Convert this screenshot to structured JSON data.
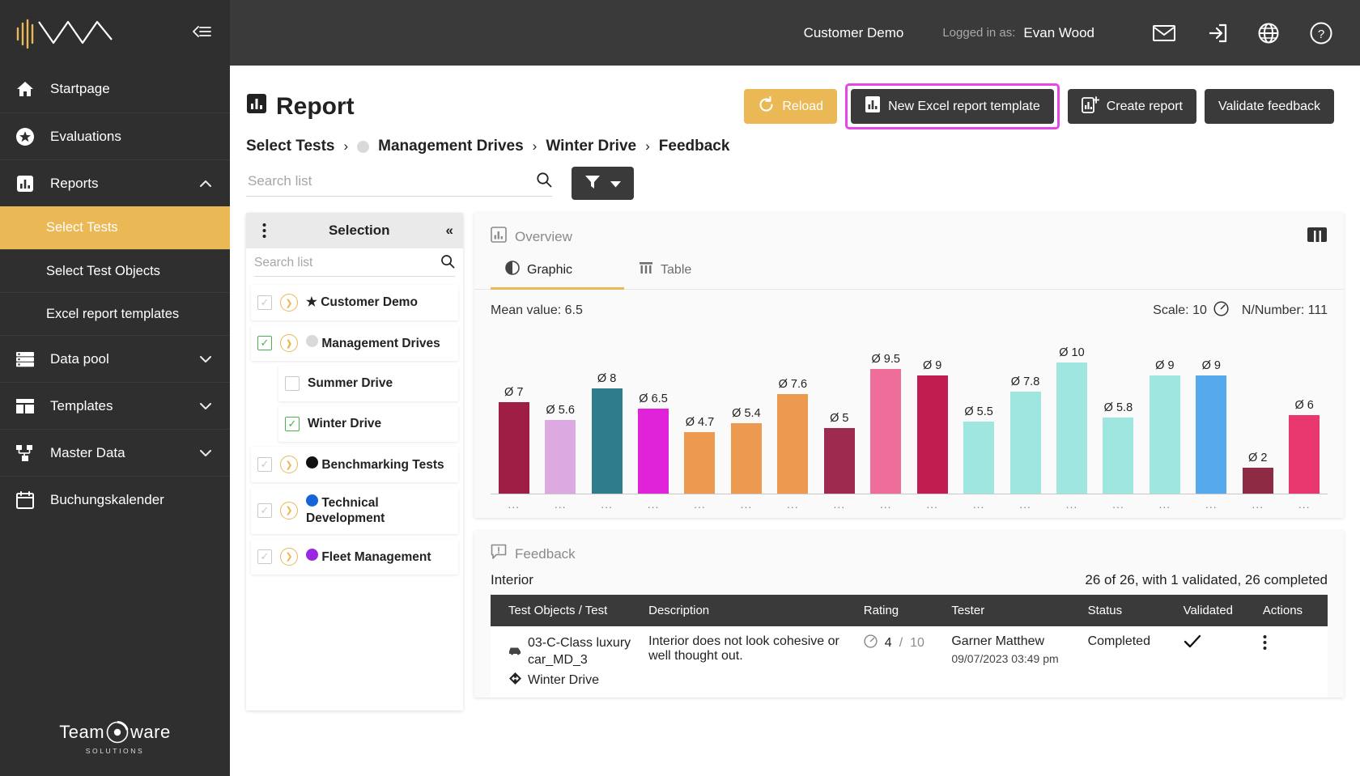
{
  "sidebar": {
    "logo_name": "waveline-logo",
    "collapse_icon": "collapse-sidebar-icon",
    "items": [
      {
        "label": "Startpage",
        "icon": "home-icon",
        "chevron": ""
      },
      {
        "label": "Evaluations",
        "icon": "star-circle-icon",
        "chevron": ""
      },
      {
        "label": "Reports",
        "icon": "bar-chart-icon",
        "chevron": "⌃"
      },
      {
        "label": "Data pool",
        "icon": "list-icon",
        "chevron": "⌄"
      },
      {
        "label": "Templates",
        "icon": "layout-icon",
        "chevron": "⌄"
      },
      {
        "label": "Master Data",
        "icon": "hierarchy-icon",
        "chevron": "⌄"
      },
      {
        "label": "Buchungskalender",
        "icon": "calendar-icon",
        "chevron": ""
      }
    ],
    "sub_items": [
      {
        "label": "Select Tests",
        "active": true
      },
      {
        "label": "Select Test Objects",
        "active": false
      },
      {
        "label": "Excel report templates",
        "active": false
      }
    ],
    "footer": {
      "brand": "Team",
      "brand2": "ware",
      "tagline": "SOLUTIONS"
    }
  },
  "topbar": {
    "customer": "Customer Demo",
    "logged_in_label": "Logged in as:",
    "user": "Evan Wood",
    "icons": [
      "mail-icon",
      "logout-icon",
      "globe-icon",
      "help-icon"
    ]
  },
  "page": {
    "title": "Report",
    "title_icon": "report-icon",
    "buttons": [
      {
        "label": "Reload",
        "icon": "refresh-icon",
        "style": "amber"
      },
      {
        "label": "New Excel report template",
        "icon": "excel-report-icon",
        "style": "dark",
        "highlighted": true
      },
      {
        "label": "Create report",
        "icon": "create-report-icon",
        "style": "dark"
      },
      {
        "label": "Validate feedback",
        "icon": "",
        "style": "dark"
      }
    ]
  },
  "breadcrumb": [
    {
      "label": "Select Tests",
      "dot": ""
    },
    {
      "label": "Management Drives",
      "dot": "#d9d9d9"
    },
    {
      "label": "Winter Drive",
      "dot": ""
    },
    {
      "label": "Feedback",
      "dot": ""
    }
  ],
  "search": {
    "placeholder": "Search list",
    "value": "",
    "icon": "search-icon"
  },
  "filter": {
    "icon": "filter-icon",
    "chevron": "▾"
  },
  "selection": {
    "title": "Selection",
    "kebab_icon": "kebab-menu-icon",
    "collapse_icon": "collapse-panel-icon",
    "search_placeholder": "Search list",
    "search_value": "",
    "tree": [
      {
        "label": "Customer Demo",
        "checkbox": "indeterminate",
        "expander": "›",
        "marker": "★",
        "marker_color": "#000000",
        "child": false
      },
      {
        "label": "Management Drives",
        "checkbox": "checked",
        "expander": "⌄",
        "marker": "●",
        "marker_color": "#d9d9d9",
        "child": false
      },
      {
        "label": "Summer Drive",
        "checkbox": "empty",
        "expander": "",
        "marker": "",
        "marker_color": "",
        "child": true
      },
      {
        "label": "Winter Drive",
        "checkbox": "checked",
        "expander": "",
        "marker": "",
        "marker_color": "",
        "child": true
      },
      {
        "label": "Benchmarking Tests",
        "checkbox": "indeterminate",
        "expander": "›",
        "marker": "●",
        "marker_color": "#111111",
        "child": false
      },
      {
        "label": "Technical Development",
        "checkbox": "indeterminate",
        "expander": "›",
        "marker": "●",
        "marker_color": "#1565d8",
        "child": false
      },
      {
        "label": "Fleet Management",
        "checkbox": "indeterminate",
        "expander": "›",
        "marker": "●",
        "marker_color": "#9c27e0",
        "child": false
      }
    ]
  },
  "overview": {
    "title": "Overview",
    "icon": "chart-icon",
    "grid_icon": "columns-icon",
    "tabs": [
      {
        "label": "Graphic",
        "icon": "pie-icon",
        "active": true
      },
      {
        "label": "Table",
        "icon": "table-icon",
        "active": false
      }
    ]
  },
  "chart_data": {
    "type": "bar",
    "title": "Mean value: 6.5",
    "mean_label": "Mean value: 6.5",
    "mean_value": 6.5,
    "scale_label": "Scale: 10",
    "scale_icon": "gauge-icon",
    "n_number_label": "N/Number: 111",
    "xlabel": "",
    "ylabel": "",
    "ylim": [
      0,
      10
    ],
    "grid": false,
    "legend": "none",
    "categories": [
      "...",
      "...",
      "...",
      "...",
      "...",
      "...",
      "...",
      "...",
      "...",
      "...",
      "...",
      "...",
      "...",
      "...",
      "...",
      "...",
      "...",
      "..."
    ],
    "value_labels": [
      "Ø 7",
      "Ø 5.6",
      "Ø 8",
      "Ø 6.5",
      "Ø 4.7",
      "Ø 5.4",
      "Ø 7.6",
      "Ø 5",
      "Ø 9.5",
      "Ø 9",
      "Ø 5.5",
      "Ø 7.8",
      "Ø 10",
      "Ø 5.8",
      "Ø 9",
      "Ø 9",
      "Ø 2",
      "Ø 6"
    ],
    "values": [
      7,
      5.6,
      8,
      6.5,
      4.7,
      5.4,
      7.6,
      5,
      9.5,
      9,
      5.5,
      7.8,
      10,
      5.8,
      9,
      9,
      2,
      6
    ],
    "colors": [
      "#9e1f43",
      "#dca9e0",
      "#2f7d8c",
      "#e022d8",
      "#eb9a4f",
      "#eb9a4f",
      "#eb9a4f",
      "#9e2a50",
      "#ef6d9b",
      "#c01d51",
      "#9fe5e0",
      "#9fe5e0",
      "#9fe5e0",
      "#9fe5e0",
      "#9fe5e0",
      "#56a9ec",
      "#8d2b45",
      "#e8386e"
    ]
  },
  "feedback": {
    "title": "Feedback",
    "icon": "feedback-icon",
    "group": "Interior",
    "count_text": "26 of 26, with 1 validated, 26 completed",
    "columns": [
      "Test Objects / Test",
      "Description",
      "Rating",
      "Tester",
      "Status",
      "Validated",
      "Actions"
    ],
    "rows": [
      {
        "object_icon": "car-icon",
        "object": "03-C-Class luxury car_MD_3",
        "test_icon": "drive-icon",
        "test": "Winter Drive",
        "description": "Interior does not look cohesive or well thought out.",
        "rating_icon": "gauge-icon",
        "rating_value": "4",
        "rating_sep": "/",
        "rating_max": "10",
        "tester": "Garner Matthew",
        "tester_date": "09/07/2023 03:49 pm",
        "status": "Completed",
        "validated_icon": "check-icon",
        "actions_icon": "kebab-menu-icon"
      }
    ]
  },
  "colors": {
    "accent": "#eab854",
    "dark": "#3a3a3a",
    "sidebar": "#2f2f2f",
    "highlight": "#e845e8",
    "green": "#4caf50"
  }
}
